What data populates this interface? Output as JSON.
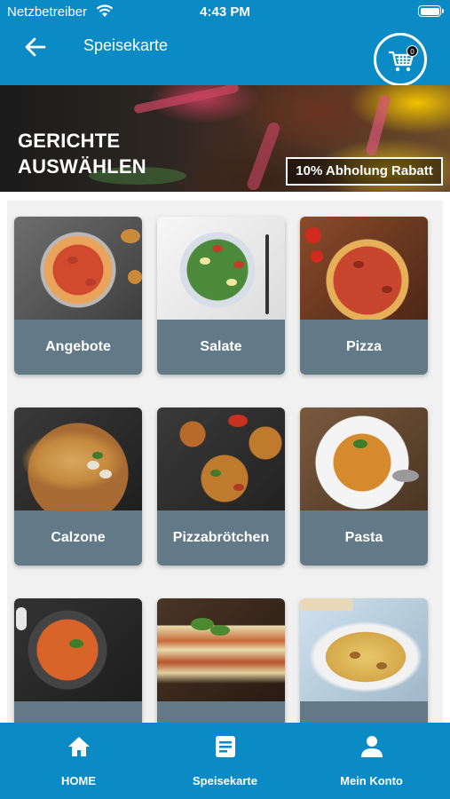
{
  "status_bar": {
    "carrier": "Netzbetreiber",
    "time": "4:43 PM"
  },
  "header": {
    "title": "Speisekarte",
    "cart_count": "0"
  },
  "hero": {
    "title_line1": "GERICHTE",
    "title_line2": "AUSWÄHLEN",
    "promo": "10% Abholung Rabatt"
  },
  "categories": [
    {
      "label": "Angebote"
    },
    {
      "label": "Salate"
    },
    {
      "label": "Pizza"
    },
    {
      "label": "Calzone"
    },
    {
      "label": "Pizzabrötchen"
    },
    {
      "label": "Pasta"
    },
    {
      "label": ""
    },
    {
      "label": ""
    },
    {
      "label": ""
    }
  ],
  "tabbar": {
    "home": "HOME",
    "menu": "Speisekarte",
    "account": "Mein Konto"
  },
  "colors": {
    "primary": "#0a8bc6",
    "card_label_bg": "#627a88"
  }
}
